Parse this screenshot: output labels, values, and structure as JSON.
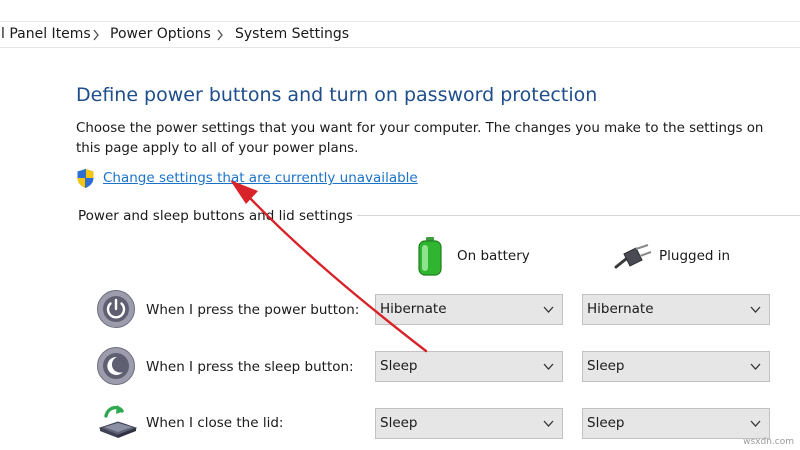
{
  "breadcrumb": {
    "items": [
      {
        "label": "l Panel Items"
      },
      {
        "label": "Power Options"
      },
      {
        "label": "System Settings"
      }
    ]
  },
  "page": {
    "title": "Define power buttons and turn on password protection",
    "description": "Choose the power settings that you want for your computer. The changes you make to the settings on this page apply to all of your power plans.",
    "change_link": "Change settings that are currently unavailable"
  },
  "section": {
    "heading": "Power and sleep buttons and lid settings",
    "columns": [
      {
        "label": "On battery",
        "icon": "battery-icon"
      },
      {
        "label": "Plugged in",
        "icon": "power-plug-icon"
      }
    ],
    "rows": [
      {
        "label": "When I press the power button:",
        "icon": "power-button-icon",
        "on_battery": "Hibernate",
        "plugged_in": "Hibernate"
      },
      {
        "label": "When I press the sleep button:",
        "icon": "sleep-button-icon",
        "on_battery": "Sleep",
        "plugged_in": "Sleep"
      },
      {
        "label": "When I close the lid:",
        "icon": "laptop-lid-icon",
        "on_battery": "Sleep",
        "plugged_in": "Sleep"
      }
    ]
  },
  "watermark": "wsxdn.com",
  "colors": {
    "title": "#1e4e8c",
    "link": "#1a73c9",
    "annotation_arrow": "#d9232a",
    "dropdown_bg": "#e6e6e6"
  }
}
